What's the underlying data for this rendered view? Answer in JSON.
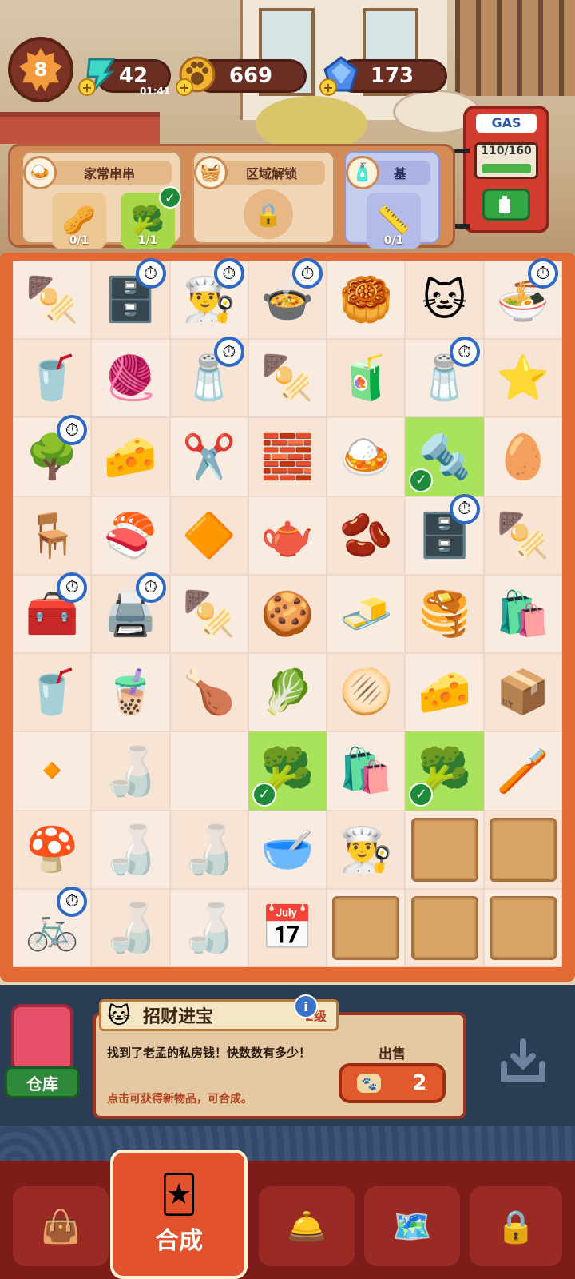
{
  "header": {
    "level": "8",
    "energy": {
      "value": "42",
      "timer": "01:41",
      "icon": "lightning-icon"
    },
    "coins": {
      "value": "669",
      "icon": "paw-coin-icon"
    },
    "gems": {
      "value": "173",
      "icon": "gem-icon"
    },
    "gas": {
      "label": "GAS",
      "value": "110/160"
    }
  },
  "tasks": [
    {
      "title": "家常串串",
      "icon": "dish-icon",
      "slots": [
        {
          "icon": "🥜",
          "count": "0/1",
          "done": false
        },
        {
          "icon": "🥦",
          "count": "1/1",
          "done": true
        }
      ]
    },
    {
      "title": "区域解锁",
      "icon": "tray-icon",
      "locked": true
    },
    {
      "title": "基",
      "icon": "roller-icon",
      "slots": [
        {
          "icon": "📏",
          "count": "0/1",
          "done": false
        }
      ]
    }
  ],
  "board": [
    [
      {
        "e": "🍢"
      },
      {
        "e": "🗄️",
        "t": 1
      },
      {
        "e": "👨‍🍳",
        "t": 1
      },
      {
        "e": "🍲",
        "t": 1
      },
      {
        "e": "🥮"
      },
      {
        "e": "🐱"
      },
      {
        "e": "🍜",
        "t": 1
      }
    ],
    [
      {
        "e": "🥤"
      },
      {
        "e": "🧶"
      },
      {
        "e": "🧂",
        "t": 1
      },
      {
        "e": "🍢"
      },
      {
        "e": "🧃"
      },
      {
        "e": "🧂",
        "t": 1
      },
      {
        "e": "⭐"
      }
    ],
    [
      {
        "e": "🌳",
        "t": 1
      },
      {
        "e": "🧀"
      },
      {
        "e": "✂️"
      },
      {
        "e": "🧱"
      },
      {
        "e": "🍛"
      },
      {
        "e": "🔩",
        "g": 1
      },
      {
        "e": "🥚"
      }
    ],
    [
      {
        "e": "🪑"
      },
      {
        "e": "🍣"
      },
      {
        "e": "🔶"
      },
      {
        "e": "🫖"
      },
      {
        "e": "🫘"
      },
      {
        "e": "🗄️",
        "t": 1
      },
      {
        "e": "🍢"
      }
    ],
    [
      {
        "e": "🧰",
        "t": 1
      },
      {
        "e": "🖨️",
        "t": 1
      },
      {
        "e": "🍢"
      },
      {
        "e": "🍪"
      },
      {
        "e": "🧈"
      },
      {
        "e": "🥞"
      },
      {
        "e": "🛍️"
      }
    ],
    [
      {
        "e": "🥤"
      },
      {
        "e": "🧋"
      },
      {
        "e": "🍗"
      },
      {
        "e": "🥬"
      },
      {
        "e": "🫓"
      },
      {
        "e": "🧀"
      },
      {
        "e": "📦"
      }
    ],
    [
      {
        "e": "🔸"
      },
      {
        "e": "🍶",
        "c": 1
      },
      {
        "e": ""
      },
      {
        "e": "🥦",
        "g": 1
      },
      {
        "e": "🛍️"
      },
      {
        "e": "🥦",
        "g": 1
      },
      {
        "e": "🪥"
      }
    ],
    [
      {
        "e": "🍄"
      },
      {
        "e": "🍶",
        "c": 1
      },
      {
        "e": "🍶",
        "c": 1
      },
      {
        "e": "🥣"
      },
      {
        "e": "👨‍🍳"
      },
      {
        "e": "crate"
      },
      {
        "e": "crate"
      }
    ],
    [
      {
        "e": "🚲",
        "t": 1
      },
      {
        "e": "🍶",
        "c": 1
      },
      {
        "e": "🍶",
        "c": 1
      },
      {
        "e": "📅"
      },
      {
        "e": "crate"
      },
      {
        "e": "crate"
      },
      {
        "e": "crate"
      }
    ]
  ],
  "warehouse": {
    "label": "仓库"
  },
  "item_info": {
    "name": "招财进宝",
    "level": "2级",
    "description": "找到了老孟的私房钱！快数数有多少！",
    "hint": "点击可获得新物品，可合成。",
    "sell_label": "出售",
    "sell_price": "2"
  },
  "nav": [
    {
      "name": "shop-tab",
      "icon": "👜"
    },
    {
      "name": "merge-tab",
      "icon": "🃏",
      "label": "合成",
      "active": true
    },
    {
      "name": "kitchen-tab",
      "icon": "🛎️"
    },
    {
      "name": "map-tab",
      "icon": "🗺️"
    },
    {
      "name": "locked-tab",
      "icon": "🔒"
    }
  ]
}
